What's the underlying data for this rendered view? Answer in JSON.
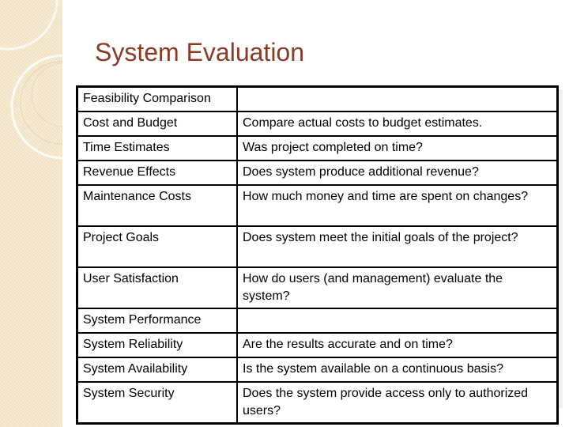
{
  "slide": {
    "title": "System Evaluation"
  },
  "table": {
    "rows": [
      {
        "criterion": "Feasibility Comparison",
        "description": "",
        "indent": false,
        "tall": false
      },
      {
        "criterion": "Cost and Budget",
        "description": "Compare actual costs to budget estimates.",
        "indent": true,
        "tall": false
      },
      {
        "criterion": "Time Estimates",
        "description": "Was project completed on time?",
        "indent": true,
        "tall": false
      },
      {
        "criterion": "Revenue Effects",
        "description": "Does system produce additional revenue?",
        "indent": true,
        "tall": false
      },
      {
        "criterion": "Maintenance Costs",
        "description": "How much money and time are spent on changes?",
        "indent": true,
        "tall": true
      },
      {
        "criterion": "Project Goals",
        "description": "Does system meet the initial goals of the project?",
        "indent": false,
        "tall": true
      },
      {
        "criterion": "User Satisfaction",
        "description": "How do users (and management) evaluate the system?",
        "indent": false,
        "tall": true
      },
      {
        "criterion": "System Performance",
        "description": "",
        "indent": false,
        "tall": false
      },
      {
        "criterion": "System Reliability",
        "description": "Are the results accurate and on time?",
        "indent": true,
        "tall": false
      },
      {
        "criterion": "System Availability",
        "description": "Is the system available on a continuous basis?",
        "indent": true,
        "tall": false
      },
      {
        "criterion": "System Security",
        "description": "Does the system provide access only to authorized users?",
        "indent": true,
        "tall": true
      }
    ]
  },
  "colors": {
    "title": "#8a3b26",
    "sidebar": "#f2e3c4",
    "border": "#000000"
  }
}
